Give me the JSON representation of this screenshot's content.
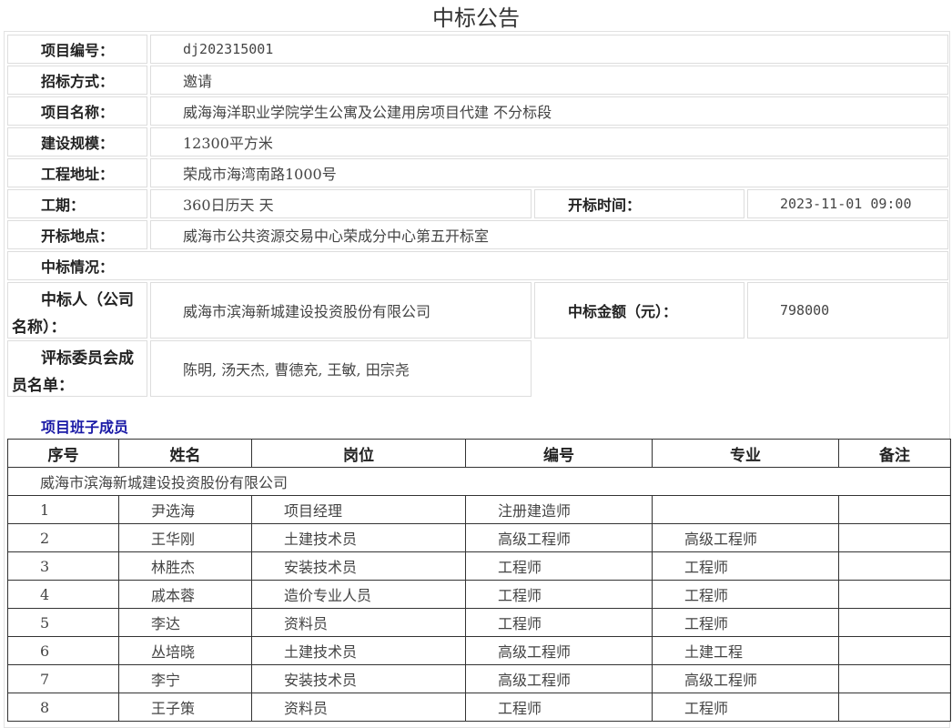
{
  "title": "中标公告",
  "fields": {
    "project_no": {
      "label": "项目编号：",
      "value": "dj202315001"
    },
    "bid_method": {
      "label": "招标方式：",
      "value": "邀请"
    },
    "project_name": {
      "label": "项目名称：",
      "value": "威海海洋职业学院学生公寓及公建用房项目代建 不分标段"
    },
    "scale": {
      "label": "建设规模：",
      "value": "12300平方米"
    },
    "address": {
      "label": "工程地址：",
      "value": "荣成市海湾南路1000号"
    },
    "duration": {
      "label": "工期：",
      "value": "360日历天 天"
    },
    "open_time": {
      "label": "开标时间：",
      "value": "2023-11-01 09:00"
    },
    "open_place": {
      "label": "开标地点：",
      "value": "威海市公共资源交易中心荣成分中心第五开标室"
    },
    "award_status": {
      "label": "中标情况："
    },
    "winner": {
      "label_line1": "中标人（公司",
      "label_line2": "名称）：",
      "value": "威海市滨海新城建设投资股份有限公司"
    },
    "amount": {
      "label": "中标金额（元）：",
      "value": "798000"
    },
    "committee": {
      "label_line1": "评标委员会成",
      "label_line2": "员名单：",
      "value": "陈明, 汤天杰, 曹德充, 王敏, 田宗尧"
    }
  },
  "team": {
    "section_title": "项目班子成员",
    "headers": [
      "序号",
      "姓名",
      "岗位",
      "编号",
      "专业",
      "备注"
    ],
    "company": "威海市滨海新城建设投资股份有限公司",
    "rows": [
      [
        "1",
        "尹选海",
        "项目经理",
        "注册建造师",
        "",
        ""
      ],
      [
        "2",
        "王华刚",
        "土建技术员",
        "高级工程师",
        "高级工程师",
        ""
      ],
      [
        "3",
        "林胜杰",
        "安装技术员",
        "工程师",
        "工程师",
        ""
      ],
      [
        "4",
        "戚本蓉",
        "造价专业人员",
        "工程师",
        "工程师",
        ""
      ],
      [
        "5",
        "李达",
        "资料员",
        "工程师",
        "工程师",
        ""
      ],
      [
        "6",
        "丛培晓",
        "土建技术员",
        "高级工程师",
        "土建工程",
        ""
      ],
      [
        "7",
        "李宁",
        "安装技术员",
        "高级工程师",
        "高级工程师",
        ""
      ],
      [
        "8",
        "王子策",
        "资料员",
        "工程师",
        "工程师",
        ""
      ]
    ]
  }
}
